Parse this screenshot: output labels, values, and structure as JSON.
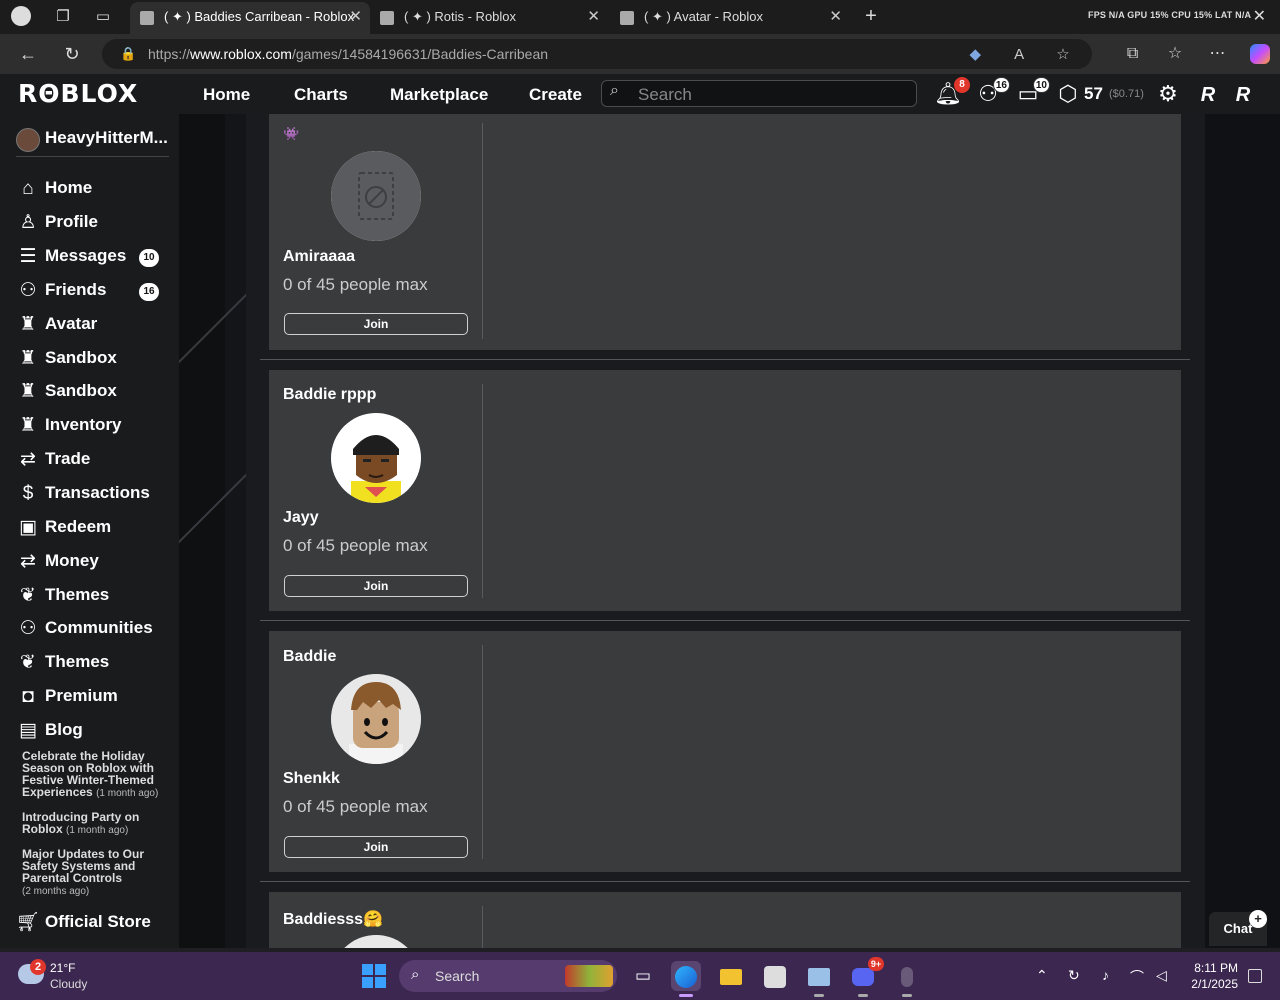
{
  "browser": {
    "tabs": [
      {
        "title": "( ✦ ) Baddies Carribean - Roblox",
        "active": true
      },
      {
        "title": "( ✦ ) Rotis - Roblox",
        "active": false
      },
      {
        "title": "( ✦ ) Avatar - Roblox",
        "active": false
      }
    ],
    "perf_overlay": "FPS  N/A  GPU  15%  CPU  15%  LAT  N/A",
    "url_prefix": "https://",
    "url_host": "www.roblox.com",
    "url_path": "/games/14584196631/Baddies-Carribean"
  },
  "header": {
    "logo": "RΘBLOX",
    "nav": [
      "Home",
      "Charts",
      "Marketplace",
      "Create"
    ],
    "search_placeholder": "Search",
    "notifications_count": "8",
    "friends_count": "16",
    "messages_count": "10",
    "robux_amount": "57",
    "robux_usd": "($0.71)"
  },
  "sidebar": {
    "username": "HeavyHitterM...",
    "items": [
      {
        "label": "Home",
        "icon": "home-icon",
        "glyph": "⌂"
      },
      {
        "label": "Profile",
        "icon": "profile-icon",
        "glyph": "♙"
      },
      {
        "label": "Messages",
        "icon": "messages-icon",
        "glyph": "☰",
        "count": "10"
      },
      {
        "label": "Friends",
        "icon": "friends-icon",
        "glyph": "⚇",
        "count": "16"
      },
      {
        "label": "Avatar",
        "icon": "avatar-icon",
        "glyph": "♜"
      },
      {
        "label": "Sandbox",
        "icon": "sandbox-icon",
        "glyph": "♜"
      },
      {
        "label": "Sandbox",
        "icon": "sandbox-icon",
        "glyph": "♜"
      },
      {
        "label": "Inventory",
        "icon": "inventory-icon",
        "glyph": "♜"
      },
      {
        "label": "Trade",
        "icon": "trade-icon",
        "glyph": "⇄"
      },
      {
        "label": "Transactions",
        "icon": "transactions-icon",
        "glyph": "$"
      },
      {
        "label": "Redeem",
        "icon": "redeem-icon",
        "glyph": "▣"
      },
      {
        "label": "Money",
        "icon": "money-icon",
        "glyph": "⇄"
      },
      {
        "label": "Themes",
        "icon": "themes-icon",
        "glyph": "❦"
      },
      {
        "label": "Communities",
        "icon": "communities-icon",
        "glyph": "⚇"
      },
      {
        "label": "Themes",
        "icon": "themes-icon",
        "glyph": "❦"
      },
      {
        "label": "Premium",
        "icon": "premium-icon",
        "glyph": "◘"
      },
      {
        "label": "Blog",
        "icon": "blog-icon",
        "glyph": "▤"
      }
    ],
    "blog_posts": [
      {
        "title": "Celebrate the Holiday Season on Roblox with Festive Winter-Themed Experiences",
        "ago": "(1 month ago)"
      },
      {
        "title": "Introducing Party on Roblox",
        "ago": "(1 month ago)"
      },
      {
        "title": "Major Updates to Our Safety Systems and Parental Controls",
        "ago": "(2 months ago)"
      }
    ],
    "official_store": "Official Store"
  },
  "servers": [
    {
      "title": "👾",
      "owner": "Amiraaaa",
      "capacity": "0 of 45 people max",
      "join": "Join",
      "thumb": "blocked"
    },
    {
      "title": "Baddie rppp",
      "owner": "Jayy",
      "capacity": "0 of 45 people max",
      "join": "Join",
      "thumb": "avatar-dark"
    },
    {
      "title": "Baddie",
      "owner": "Shenkk",
      "capacity": "0 of 45 people max",
      "join": "Join",
      "thumb": "avatar-classic"
    },
    {
      "title": "Baddiesss🤗",
      "owner": "",
      "capacity": "",
      "join": "",
      "thumb": "partial"
    }
  ],
  "chat": {
    "label": "Chat"
  },
  "taskbar": {
    "weather_badge": "2",
    "temperature": "21°F",
    "condition": "Cloudy",
    "search_label": "Search",
    "discord_badge": "9+",
    "time": "8:11 PM",
    "date": "2/1/2025"
  },
  "colors": {
    "page_bg": "#1a1b1e",
    "card_bg": "#393b3d",
    "sidebar_bg": "#191b1d",
    "badge_red": "#e0362c",
    "taskbar_bg": "#3b2750"
  }
}
